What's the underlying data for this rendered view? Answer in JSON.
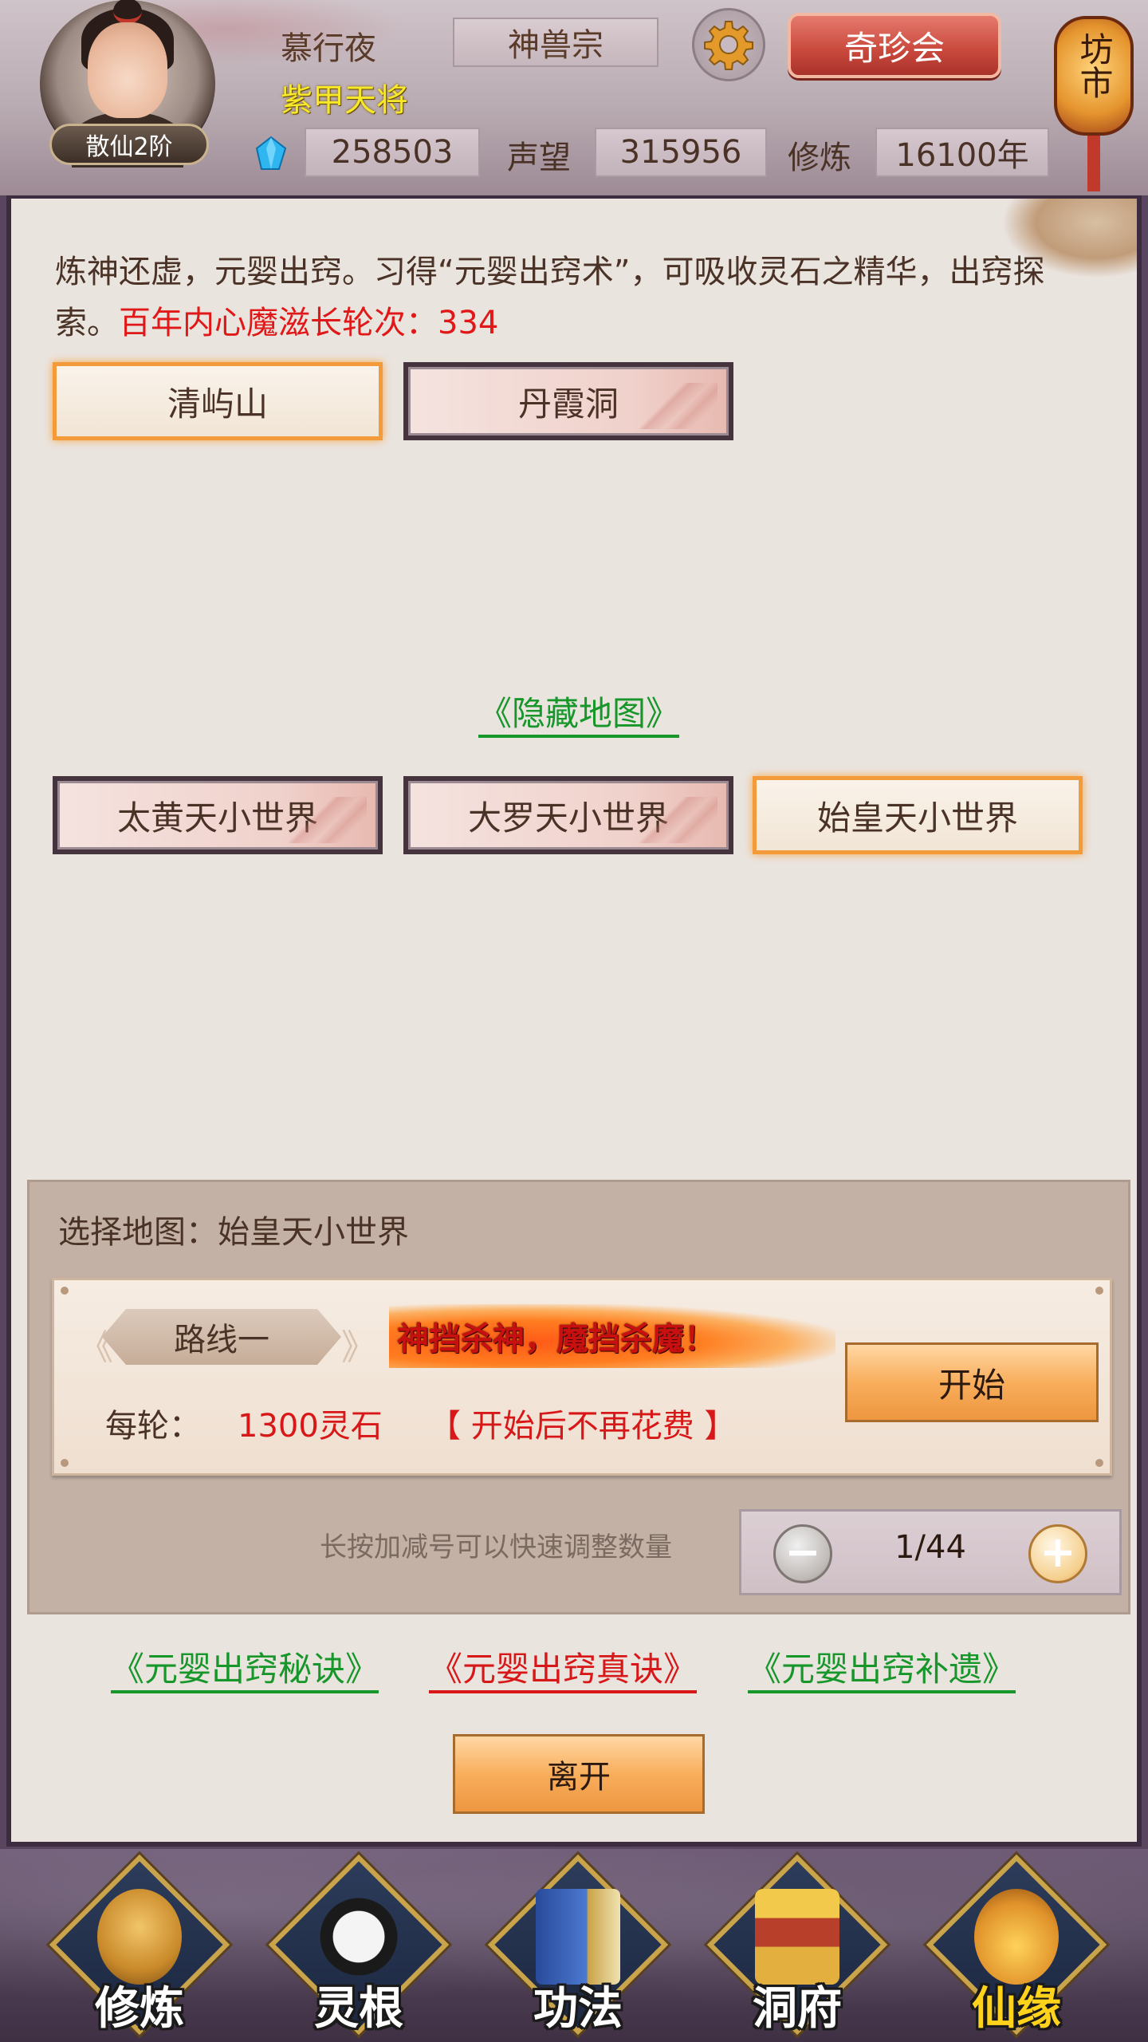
{
  "header": {
    "player_name": "慕行夜",
    "player_title": "紫甲天将",
    "rank": "散仙2阶",
    "sect": "神兽宗",
    "treasure_button": "奇珍会",
    "market_label": "坊市",
    "stats": {
      "spirit_stones": "258503",
      "reputation_label": "声望",
      "reputation": "315956",
      "cultivation_label": "修炼",
      "cultivation": "16100年"
    }
  },
  "intro": {
    "text": "炼神还虚，元婴出窍。习得“元婴出窍术”，可吸收灵石之精华，出窍探索。",
    "highlight": "百年内心魔滋长轮次：334"
  },
  "maps_row1": [
    {
      "label": "清屿山",
      "selected": true
    },
    {
      "label": "丹霞洞",
      "selected": false
    }
  ],
  "hidden_map_link": "《隐藏地图》",
  "maps_row2": [
    {
      "label": "太黄天小世界",
      "selected": false
    },
    {
      "label": "大罗天小世界",
      "selected": false
    },
    {
      "label": "始皇天小世界",
      "selected": true
    }
  ],
  "control": {
    "selected_map": "选择地图：始皇天小世界",
    "route_label": "路线一",
    "slogan": "神挡杀神，魔挡杀魔！",
    "cost_label": "每轮：",
    "cost_value": "1300灵石",
    "no_fee_note": "【 开始后不再花费 】",
    "start_button": "开始",
    "hint": "长按加减号可以快速调整数量",
    "stepper_value": "1/44",
    "minus": "−",
    "plus": "+"
  },
  "guide_links": [
    "《元婴出窍秘诀》",
    "《元婴出窍真诀》",
    "《元婴出窍补遗》"
  ],
  "leave_button": "离开",
  "nav": [
    {
      "label": "修炼",
      "icon": "cultivation-icon",
      "active": false
    },
    {
      "label": "灵根",
      "icon": "spirit-root-icon",
      "active": false
    },
    {
      "label": "功法",
      "icon": "technique-book-icon",
      "active": false
    },
    {
      "label": "洞府",
      "icon": "cave-dwelling-icon",
      "active": false
    },
    {
      "label": "仙缘",
      "icon": "gourd-icon",
      "active": true
    }
  ],
  "colors": {
    "highlight_red": "#e01818",
    "link_green": "#17962a",
    "link_red": "#d81818",
    "title_yellow": "#f7e928",
    "selected_border": "#f39b3a"
  }
}
